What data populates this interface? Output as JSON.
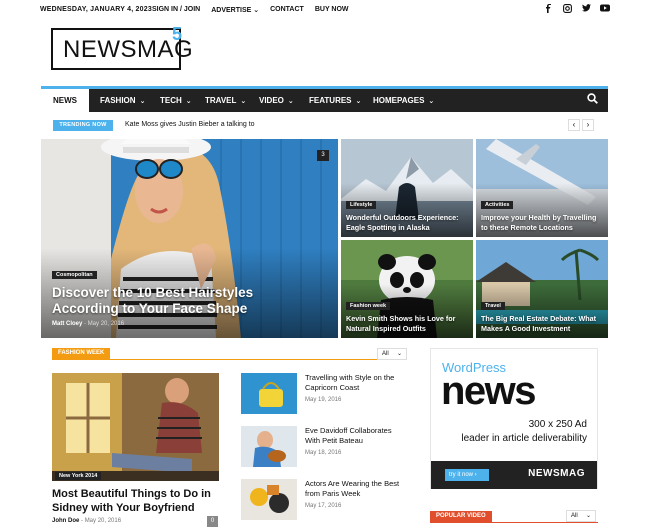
{
  "topbar": {
    "date": "WEDNESDAY, JANUARY 4, 2023",
    "links": [
      "SIGN IN / JOIN",
      "ADVERTISE",
      "CONTACT",
      "BUY NOW"
    ],
    "advertise_chevron": "⌄"
  },
  "logo": {
    "text": "NEWSMAG",
    "sup": "5"
  },
  "nav": {
    "items": [
      {
        "label": "NEWS",
        "active": true
      },
      {
        "label": "FASHION"
      },
      {
        "label": "TECH"
      },
      {
        "label": "TRAVEL"
      },
      {
        "label": "VIDEO"
      },
      {
        "label": "FEATURES"
      },
      {
        "label": "HOMEPAGES"
      }
    ],
    "accent": "#4db2ec"
  },
  "trending": {
    "badge": "TRENDING NOW",
    "text": "Kate Moss gives Justin Bieber a talking to",
    "prev": "‹",
    "next": "›"
  },
  "hero": {
    "main": {
      "category": "Cosmopolitan",
      "title_line1": "Discover the 10 Best Hairstyles",
      "title_line2": "According to Your Face Shape",
      "author": "Matt Cloey",
      "date": "May 20, 2016",
      "comments": "3"
    },
    "tiles": [
      {
        "category": "Lifestyle",
        "line1": "Wonderful Outdoors Experience:",
        "line2": "Eagle Spotting in Alaska"
      },
      {
        "category": "Activities",
        "line1": "Improve your Health by Travelling",
        "line2": "to these Remote Locations"
      },
      {
        "category": "Fashion week",
        "line1": "Kevin Smith Shows his Love for",
        "line2": "Natural Inspired Outfits"
      },
      {
        "category": "Travel",
        "line1": "The Big Real Estate Debate: What",
        "line2": "Makes A Good Investment"
      }
    ]
  },
  "fashion": {
    "badge": "FASHION WEEK",
    "badge_color": "#f39c12",
    "filter": "All",
    "featured": {
      "category": "New York 2014",
      "title_line1": "Most Beautiful Things to Do in",
      "title_line2": "Sidney with Your Boyfriend",
      "author": "John Doe",
      "date": "May 20, 2016",
      "comments": "0"
    },
    "items": [
      {
        "line1": "Travelling with Style on the",
        "line2": "Capricorn Coast",
        "date": "May 19, 2016"
      },
      {
        "line1": "Eve Davidoff Collaborates",
        "line2": "With Petit Bateau",
        "date": "May 18, 2016"
      },
      {
        "line1": "Actors Are Wearing the Best",
        "line2": "from Paris Week",
        "date": "May 17, 2016"
      }
    ]
  },
  "ad": {
    "brand": "WordPress",
    "headline": "news",
    "size": "300 x 250 Ad",
    "tagline": "leader in article deliverability",
    "cta": "try it now ›",
    "logo": "NEWSMAG"
  },
  "popular": {
    "badge": "POPULAR VIDEO",
    "badge_color": "#e14e2b",
    "filter": "All"
  }
}
